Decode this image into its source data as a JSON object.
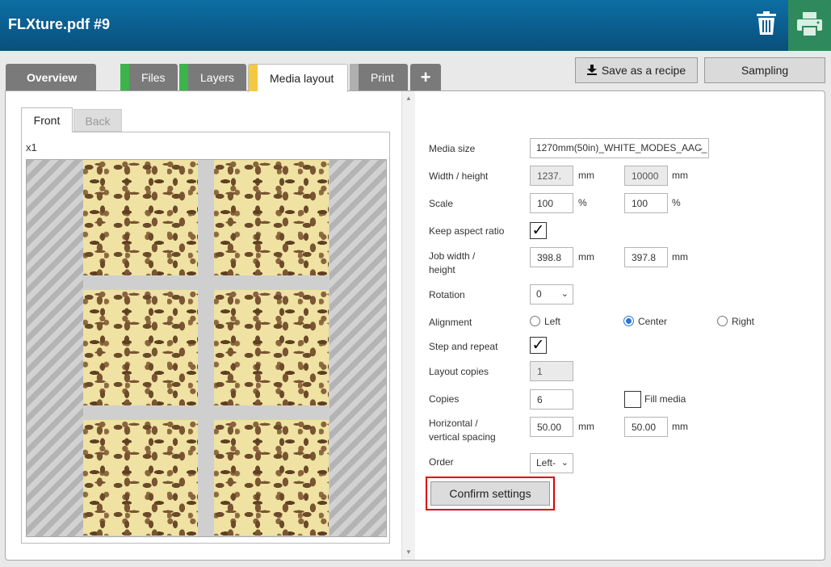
{
  "header": {
    "title": "FLXture.pdf #9"
  },
  "tabs": [
    {
      "label": "Overview",
      "status_color": ""
    },
    {
      "label": "Files",
      "status_color": "#3cb44b"
    },
    {
      "label": "Layers",
      "status_color": "#3cb44b"
    },
    {
      "label": "Media layout",
      "status_color": "#f5c842"
    },
    {
      "label": "Print",
      "status_color": "#b0b0b0"
    },
    {
      "label": "+"
    }
  ],
  "actions": {
    "save_recipe": "Save as a recipe",
    "sampling": "Sampling"
  },
  "preview": {
    "front_tab": "Front",
    "back_tab": "Back",
    "copies_indicator": "x1"
  },
  "form": {
    "media_size": {
      "label": "Media size",
      "value": "1270mm(50in)_WHITE_MODES_AAC_"
    },
    "width_height": {
      "label": "Width / height",
      "width": "1237.",
      "height": "10000",
      "unit": "mm"
    },
    "scale": {
      "label": "Scale",
      "x": "100",
      "y": "100",
      "unit": "%"
    },
    "keep_aspect": {
      "label": "Keep aspect ratio",
      "checked": true,
      "mark": "✓"
    },
    "job_size": {
      "label": "Job width / height",
      "width": "398.8",
      "height": "397.8",
      "unit": "mm"
    },
    "rotation": {
      "label": "Rotation",
      "value": "0"
    },
    "alignment": {
      "label": "Alignment",
      "options": [
        "Left",
        "Center",
        "Right"
      ],
      "selected": "Center"
    },
    "step_repeat": {
      "label": "Step and repeat",
      "checked": true,
      "mark": "✓"
    },
    "layout_copies": {
      "label": "Layout copies",
      "value": "1"
    },
    "copies": {
      "label": "Copies",
      "value": "6",
      "fill_media_label": "Fill media",
      "fill_media_checked": false
    },
    "spacing": {
      "label": "Horizontal / vertical spacing",
      "horizontal": "50.00",
      "vertical": "50.00",
      "unit": "mm"
    },
    "order": {
      "label": "Order",
      "value": "Left-"
    },
    "confirm": "Confirm settings"
  }
}
